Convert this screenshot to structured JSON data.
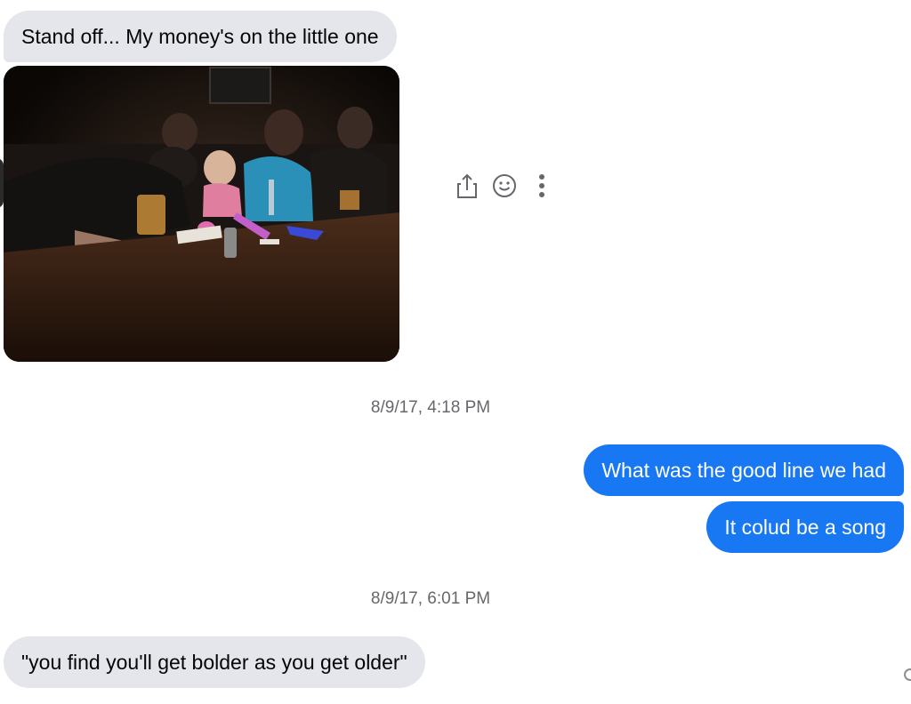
{
  "messages": [
    {
      "direction": "incoming",
      "text": "Stand off... My money's on the little one"
    },
    {
      "direction": "outgoing",
      "text": "What was the good line we had"
    },
    {
      "direction": "outgoing",
      "text": "It colud be a song"
    },
    {
      "direction": "incoming",
      "text": "\"you find you'll get bolder as you get older\""
    }
  ],
  "timestamps": [
    "8/9/17, 4:18 PM",
    "8/9/17, 6:01 PM"
  ],
  "photo": {
    "subject": "group at restaurant table photo"
  },
  "actions": {
    "share_icon": "share-icon",
    "react_icon": "smiley-icon",
    "more_icon": "more-vertical-icon"
  },
  "colors": {
    "incoming_bubble": "#e4e6eb",
    "outgoing_bubble": "#1877f2",
    "timestamp_text": "#65676b",
    "icon": "#65676b"
  }
}
